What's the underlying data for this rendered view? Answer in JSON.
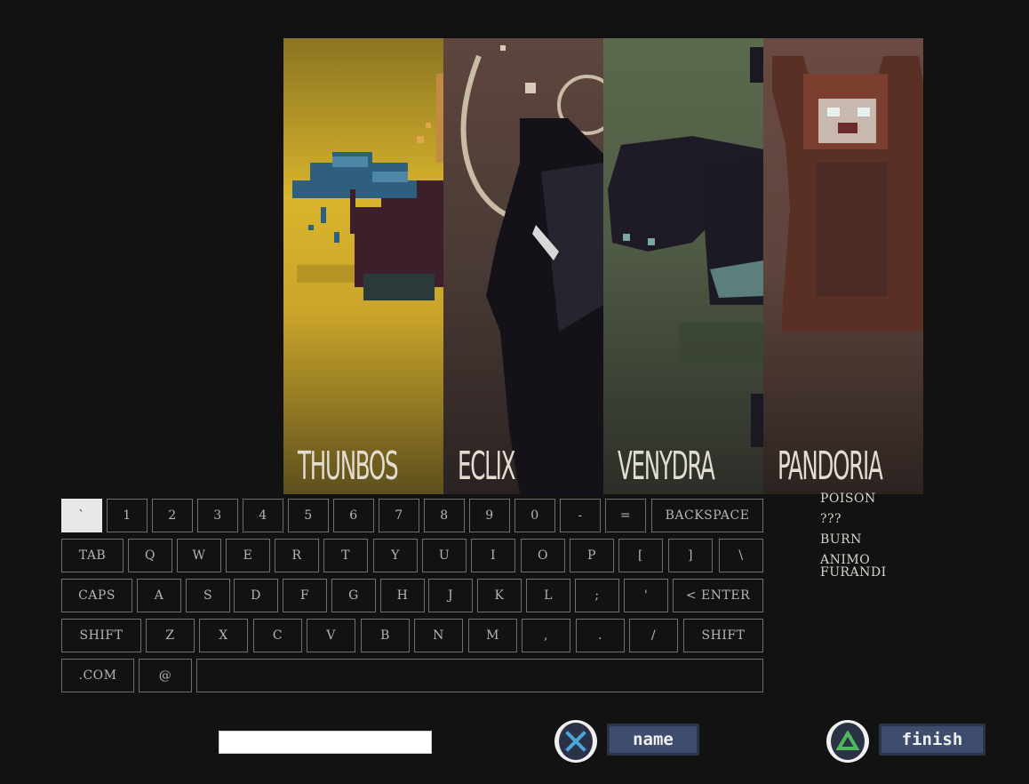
{
  "characters": [
    {
      "name": "THUNBOS"
    },
    {
      "name": "ECLIX"
    },
    {
      "name": "VENYDRA"
    },
    {
      "name": "PANDORIA"
    }
  ],
  "moves": [
    "POISON",
    "???",
    "BURN",
    "ANIMO FURANDI"
  ],
  "keyboard": {
    "row1": [
      "`",
      "1",
      "2",
      "3",
      "4",
      "5",
      "6",
      "7",
      "8",
      "9",
      "0",
      "-",
      "=",
      "BACKSPACE"
    ],
    "row2": [
      "TAB",
      "Q",
      "W",
      "E",
      "R",
      "T",
      "Y",
      "U",
      "I",
      "O",
      "P",
      "[",
      "]",
      "\\"
    ],
    "row3": [
      "CAPS",
      "A",
      "S",
      "D",
      "F",
      "G",
      "H",
      "J",
      "K",
      "L",
      ";",
      "'",
      "< ENTER"
    ],
    "row4": [
      "SHIFT",
      "Z",
      "X",
      "C",
      "V",
      "B",
      "N",
      "M",
      ",",
      ".",
      "/",
      "SHIFT"
    ],
    "row5": [
      ".COM",
      "@",
      ""
    ]
  },
  "name_input": {
    "value": ""
  },
  "buttons": {
    "name": {
      "label": "name",
      "icon": "cross-icon"
    },
    "finish": {
      "label": "finish",
      "icon": "triangle-icon"
    }
  },
  "colors": {
    "accent_blue": "#3e4c6d",
    "cross_icon": "#4aa6d6",
    "triangle_icon": "#4fb85a"
  }
}
